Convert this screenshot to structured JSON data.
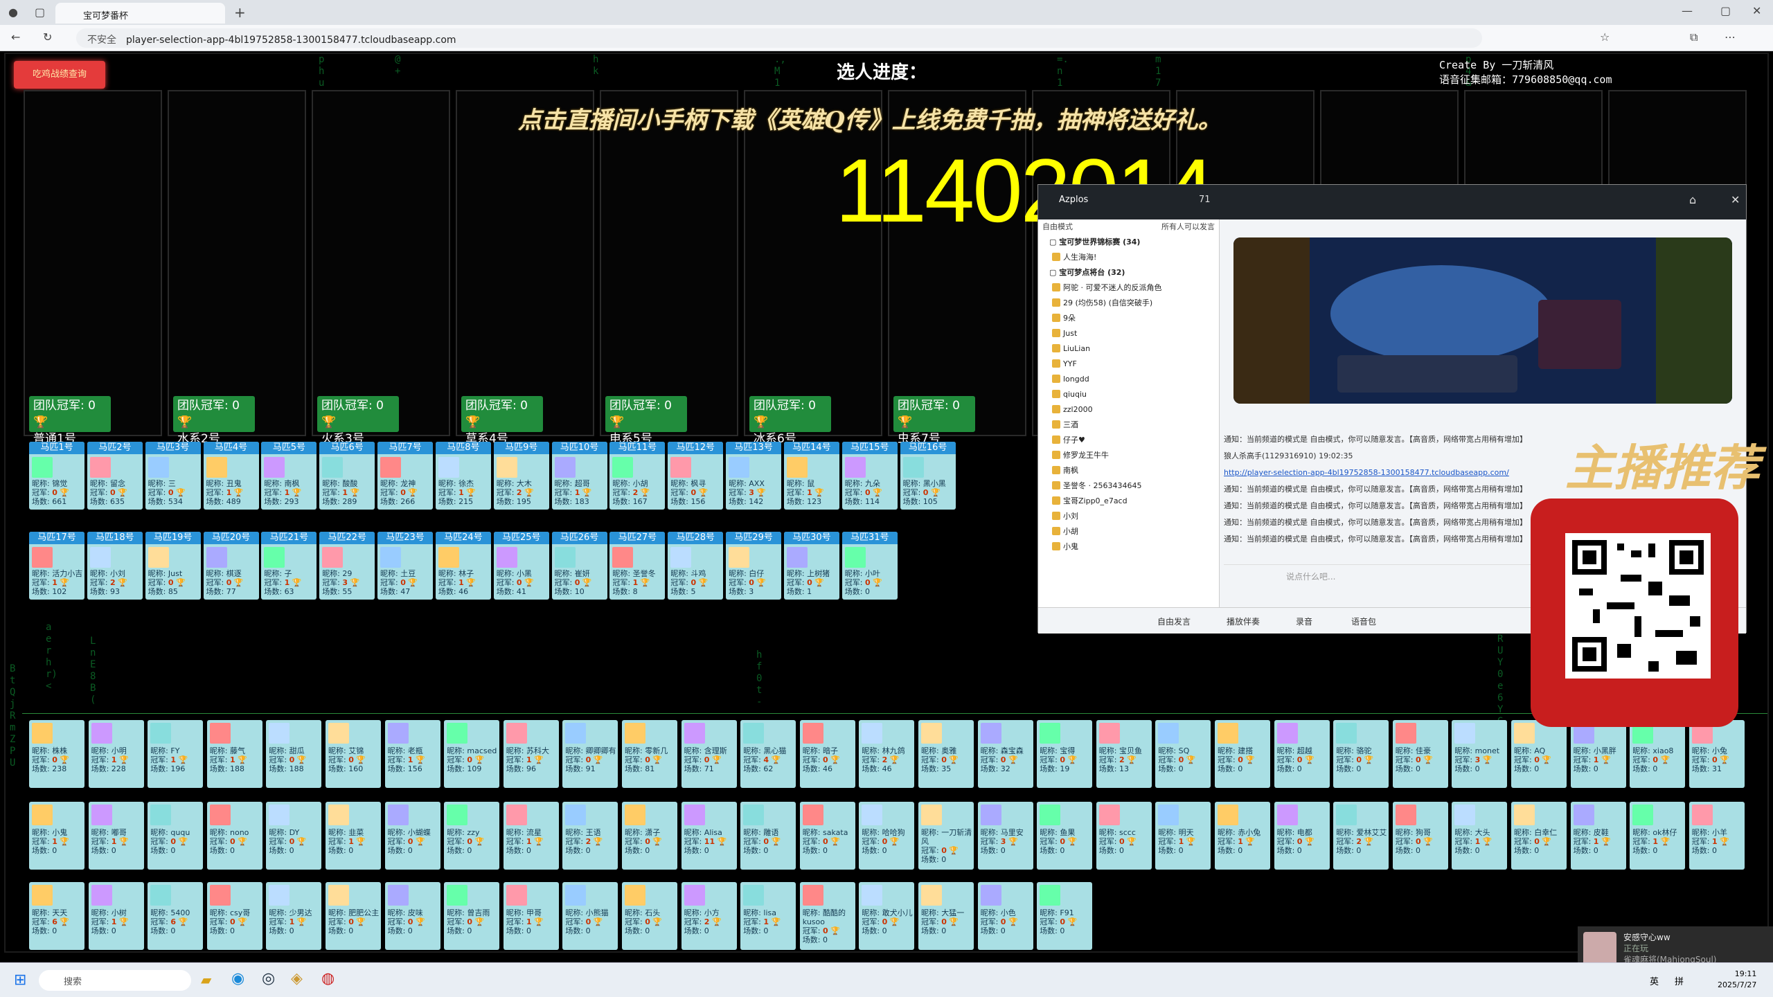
{
  "browser": {
    "tab_title": "宝可梦番杯",
    "security": "不安全",
    "url": "player-selection-app-4bl19752858-1300158477.tcloudbaseapp.com"
  },
  "app": {
    "record_button": "吃鸡战绩查询",
    "progress_title": "选人进度：",
    "credit_line1": "Create By 一刀斩清风",
    "credit_line2": "语音征集邮箱：779608850@qq.com",
    "banner": "点击直播间小手柄下载《英雄Q传》上线免费千抽，抽神将送好礼。",
    "counter": "11402014",
    "teams": [
      {
        "label": "团队冠军: 0",
        "name": "普通1号"
      },
      {
        "label": "团队冠军: 0",
        "name": "水系2号"
      },
      {
        "label": "团队冠军: 0",
        "name": "火系3号"
      },
      {
        "label": "团队冠军: 0",
        "name": "草系4号"
      },
      {
        "label": "团队冠军: 0",
        "name": "电系5号"
      },
      {
        "label": "团队冠军: 0",
        "name": "冰系6号"
      },
      {
        "label": "团队冠军: 0",
        "name": "虫系7号"
      }
    ],
    "matched": [
      {
        "h": "马匹1号",
        "n": "昵称: 锦觉",
        "g": "0",
        "c": "661"
      },
      {
        "h": "马匹2号",
        "n": "昵称: 留念",
        "g": "0",
        "c": "635"
      },
      {
        "h": "马匹3号",
        "n": "昵称: 三",
        "g": "0",
        "c": "534"
      },
      {
        "h": "马匹4号",
        "n": "昵称: 丑鬼",
        "g": "1",
        "c": "489"
      },
      {
        "h": "马匹5号",
        "n": "昵称: 南枫",
        "g": "1",
        "c": "293"
      },
      {
        "h": "马匹6号",
        "n": "昵称: 酸酸",
        "g": "1",
        "c": "289"
      },
      {
        "h": "马匹7号",
        "n": "昵称: 龙神",
        "g": "0",
        "c": "266"
      },
      {
        "h": "马匹8号",
        "n": "昵称: 徐杰",
        "g": "1",
        "c": "215"
      },
      {
        "h": "马匹9号",
        "n": "昵称: 大木",
        "g": "2",
        "c": "195"
      },
      {
        "h": "马匹10号",
        "n": "昵称: 超哥",
        "g": "1",
        "c": "183"
      },
      {
        "h": "马匹11号",
        "n": "昵称: 小胡",
        "g": "2",
        "c": "167"
      },
      {
        "h": "马匹12号",
        "n": "昵称: 枫寻",
        "g": "0",
        "c": "156"
      },
      {
        "h": "马匹13号",
        "n": "昵称: AXX",
        "g": "3",
        "c": "142"
      },
      {
        "h": "马匹14号",
        "n": "昵称: 鼠",
        "g": "1",
        "c": "123"
      },
      {
        "h": "马匹15号",
        "n": "昵称: 九朵",
        "g": "0",
        "c": "114"
      },
      {
        "h": "马匹16号",
        "n": "昵称: 黑小黑",
        "g": "0",
        "c": "105"
      },
      {
        "h": "马匹17号",
        "n": "昵称: 活力小吉",
        "g": "1",
        "c": "102"
      },
      {
        "h": "马匹18号",
        "n": "昵称: 小刘",
        "g": "2",
        "c": "93"
      },
      {
        "h": "马匹19号",
        "n": "昵称: Just",
        "g": "0",
        "c": "85"
      },
      {
        "h": "马匹20号",
        "n": "昵称: 棋逐",
        "g": "0",
        "c": "77"
      },
      {
        "h": "马匹21号",
        "n": "昵称: 子",
        "g": "1",
        "c": "63"
      },
      {
        "h": "马匹22号",
        "n": "昵称: 29",
        "g": "3",
        "c": "55"
      },
      {
        "h": "马匹23号",
        "n": "昵称: 土豆",
        "g": "0",
        "c": "47"
      },
      {
        "h": "马匹24号",
        "n": "昵称: 林子",
        "g": "1",
        "c": "46"
      },
      {
        "h": "马匹25号",
        "n": "昵称: 小黑",
        "g": "0",
        "c": "41"
      },
      {
        "h": "马匹26号",
        "n": "昵称: 崔妍",
        "g": "0",
        "c": "10"
      },
      {
        "h": "马匹27号",
        "n": "昵称: 圣誉冬",
        "g": "1",
        "c": "8"
      },
      {
        "h": "马匹28号",
        "n": "昵称: 斗鸡",
        "g": "0",
        "c": "5"
      },
      {
        "h": "马匹29号",
        "n": "昵称: 白仔",
        "g": "0",
        "c": "3"
      },
      {
        "h": "马匹30号",
        "n": "昵称: 上树猪",
        "g": "0",
        "c": "1"
      },
      {
        "h": "马匹31号",
        "n": "昵称: 小叶",
        "g": "0",
        "c": "0"
      }
    ],
    "pool_row1": [
      {
        "n": "昵称: 株株",
        "g": "0",
        "c": "238"
      },
      {
        "n": "昵称: 小明",
        "g": "1",
        "c": "228"
      },
      {
        "n": "昵称: FY",
        "g": "1",
        "c": "196"
      },
      {
        "n": "昵称: 藤气",
        "g": "1",
        "c": "188"
      },
      {
        "n": "昵称: 甜瓜",
        "g": "0",
        "c": "188"
      },
      {
        "n": "昵称: 艾锦",
        "g": "0",
        "c": "160"
      },
      {
        "n": "昵称: 老瓶",
        "g": "1",
        "c": "156"
      },
      {
        "n": "昵称: macsed",
        "g": "0",
        "c": "109"
      },
      {
        "n": "昵称: 苏科大",
        "g": "1",
        "c": "96"
      },
      {
        "n": "昵称: 卿卿卿有",
        "g": "0",
        "c": "91"
      },
      {
        "n": "昵称: 零新几",
        "g": "0",
        "c": "81"
      },
      {
        "n": "昵称: 含理斯",
        "g": "0",
        "c": "71"
      },
      {
        "n": "昵称: 黑心猫",
        "g": "4",
        "c": "62"
      },
      {
        "n": "昵称: 暗子",
        "g": "0",
        "c": "46"
      },
      {
        "n": "昵称: 林九鸽",
        "g": "2",
        "c": "46"
      },
      {
        "n": "昵称: 奥雅",
        "g": "0",
        "c": "35"
      },
      {
        "n": "昵称: 森宝森",
        "g": "0",
        "c": "32"
      },
      {
        "n": "昵称: 宝得",
        "g": "0",
        "c": "19"
      },
      {
        "n": "昵称: 宝贝鱼",
        "g": "2",
        "c": "13"
      },
      {
        "n": "昵称: SQ",
        "g": "0",
        "c": "0"
      },
      {
        "n": "昵称: 建搭",
        "g": "0",
        "c": "0"
      },
      {
        "n": "昵称: 超越",
        "g": "0",
        "c": "0"
      },
      {
        "n": "昵称: 骆驼",
        "g": "0",
        "c": "0"
      },
      {
        "n": "昵称: 佳豪",
        "g": "0",
        "c": "0"
      },
      {
        "n": "昵称: monet",
        "g": "3",
        "c": "0"
      },
      {
        "n": "昵称: AQ",
        "g": "0",
        "c": "0"
      },
      {
        "n": "昵称: 小黑胖",
        "g": "1",
        "c": "0"
      },
      {
        "n": "昵称: xiao8",
        "g": "0",
        "c": "0"
      },
      {
        "n": "昵称: 小兔",
        "g": "0",
        "c": "31"
      }
    ],
    "pool_row2": [
      {
        "n": "昵称: 小鬼",
        "g": "1",
        "c": "0"
      },
      {
        "n": "昵称: 嘟哥",
        "g": "1",
        "c": "0"
      },
      {
        "n": "昵称: ququ",
        "g": "0",
        "c": "0"
      },
      {
        "n": "昵称: nono",
        "g": "0",
        "c": "0"
      },
      {
        "n": "昵称: DY",
        "g": "0",
        "c": "0"
      },
      {
        "n": "昵称: 韭菜",
        "g": "1",
        "c": "0"
      },
      {
        "n": "昵称: 小蝴蝶",
        "g": "0",
        "c": "0"
      },
      {
        "n": "昵称: zzy",
        "g": "0",
        "c": "0"
      },
      {
        "n": "昵称: 流星",
        "g": "1",
        "c": "0"
      },
      {
        "n": "昵称: 王语",
        "g": "2",
        "c": "0"
      },
      {
        "n": "昵称: 潇子",
        "g": "0",
        "c": "0"
      },
      {
        "n": "昵称: Alisa",
        "g": "11",
        "c": "0"
      },
      {
        "n": "昵称: 雕语",
        "g": "0",
        "c": "0"
      },
      {
        "n": "昵称: sakata",
        "g": "0",
        "c": "0"
      },
      {
        "n": "昵称: 哈哈狗",
        "g": "0",
        "c": "0"
      },
      {
        "n": "昵称: 一刀斩清风",
        "g": "0",
        "c": "0"
      },
      {
        "n": "昵称: 马里安",
        "g": "3",
        "c": "0"
      },
      {
        "n": "昵称: 鱼果",
        "g": "0",
        "c": "0"
      },
      {
        "n": "昵称: sccc",
        "g": "0",
        "c": "0"
      },
      {
        "n": "昵称: 明天",
        "g": "1",
        "c": "0"
      },
      {
        "n": "昵称: 赤小兔",
        "g": "1",
        "c": "0"
      },
      {
        "n": "昵称: 电都",
        "g": "0",
        "c": "0"
      },
      {
        "n": "昵称: 爱林艾艾",
        "g": "2",
        "c": "0"
      },
      {
        "n": "昵称: 狗哥",
        "g": "0",
        "c": "0"
      },
      {
        "n": "昵称: 大头",
        "g": "1",
        "c": "0"
      },
      {
        "n": "昵称: 白幸仁",
        "g": "0",
        "c": "0"
      },
      {
        "n": "昵称: 皮鞋",
        "g": "1",
        "c": "0"
      },
      {
        "n": "昵称: ok林仔",
        "g": "1",
        "c": "0"
      },
      {
        "n": "昵称: 小羊",
        "g": "1",
        "c": "0"
      }
    ],
    "pool_row3": [
      {
        "n": "昵称: 天天",
        "g": "6",
        "c": "0"
      },
      {
        "n": "昵称: 小树",
        "g": "1",
        "c": "0"
      },
      {
        "n": "昵称: 5400",
        "g": "6",
        "c": "0"
      },
      {
        "n": "昵称: csy哥",
        "g": "0",
        "c": "0"
      },
      {
        "n": "昵称: 少男达",
        "g": "1",
        "c": "0"
      },
      {
        "n": "昵称: 肥肥公主",
        "g": "0",
        "c": "0"
      },
      {
        "n": "昵称: 皮味",
        "g": "0",
        "c": "0"
      },
      {
        "n": "昵称: 曾吉雨",
        "g": "0",
        "c": "0"
      },
      {
        "n": "昵称: 甲哥",
        "g": "1",
        "c": "0"
      },
      {
        "n": "昵称: 小熊猫",
        "g": "0",
        "c": "0"
      },
      {
        "n": "昵称: 石头",
        "g": "0",
        "c": "0"
      },
      {
        "n": "昵称: 小方",
        "g": "2",
        "c": "0"
      },
      {
        "n": "昵称: lisa",
        "g": "1",
        "c": "0"
      },
      {
        "n": "昵称: 酷酷的kusoo",
        "g": "0",
        "c": "0"
      },
      {
        "n": "昵称: 敢犬小儿",
        "g": "0",
        "c": "0"
      },
      {
        "n": "昵称: 大猛一",
        "g": "0",
        "c": "0"
      },
      {
        "n": "昵称: 小色",
        "g": "0",
        "c": "0"
      },
      {
        "n": "昵称: F91",
        "g": "0",
        "c": "0"
      }
    ]
  },
  "voice": {
    "channel_name": "Azplos",
    "viewer_count": "71",
    "mode_label": "自由模式",
    "mode_note": "所有人可以发言",
    "channel_list": [
      {
        "t": "宝可梦世界锦标赛 (34)",
        "grp": true
      },
      {
        "t": "人生海海!"
      },
      {
        "t": "宝可梦点将台 (32)",
        "grp": true
      },
      {
        "t": "阿驼 · 可爱不迷人的反派角色"
      },
      {
        "t": "29 (均伤58) (自信突破手)"
      },
      {
        "t": "9朵"
      },
      {
        "t": "Just"
      },
      {
        "t": "LiuLian"
      },
      {
        "t": "YYF"
      },
      {
        "t": "longdd"
      },
      {
        "t": "qiuqiu"
      },
      {
        "t": "zzl2000"
      },
      {
        "t": "三酒"
      },
      {
        "t": "仔子♥"
      },
      {
        "t": "修罗龙王牛牛"
      },
      {
        "t": "南枫"
      },
      {
        "t": "圣誉冬 · 2563434645"
      },
      {
        "t": "宝哥Zipp0_e7acd"
      },
      {
        "t": "小刘"
      },
      {
        "t": "小胡"
      },
      {
        "t": "小鬼"
      }
    ],
    "chat": [
      "通知：当前频道的模式是 自由模式，你可以随意发言。【高音质，网络带宽占用稍有增加】",
      "狼人杀高手(1129316910) 19:02:35",
      "http://player-selection-app-4bl19752858-1300158477.tcloudbaseapp.com/",
      "通知：当前频道的模式是 自由模式，你可以随意发言。【高音质，网络带宽占用稍有增加】",
      "通知：当前频道的模式是 自由模式，你可以随意发言。【高音质，网络带宽占用稍有增加】",
      "通知：当前频道的模式是 自由模式，你可以随意发言。【高音质，网络带宽占用稍有增加】",
      "通知：当前频道的模式是 自由模式，你可以随意发言。【高音质，网络带宽占用稍有增加】"
    ],
    "input_placeholder": "说点什么吧...",
    "bottom": [
      "自由发言",
      "播放伴奏",
      "录音",
      "语音包"
    ]
  },
  "qr_title": "主播推荐",
  "notification": {
    "name": "安感守心ww",
    "status": "正在玩",
    "game": "雀魂麻将(MahjongSoul)"
  },
  "taskbar": {
    "search": "搜索",
    "ime": "英",
    "lang": "拼",
    "time": "19:11",
    "date": "2025/7/27"
  }
}
